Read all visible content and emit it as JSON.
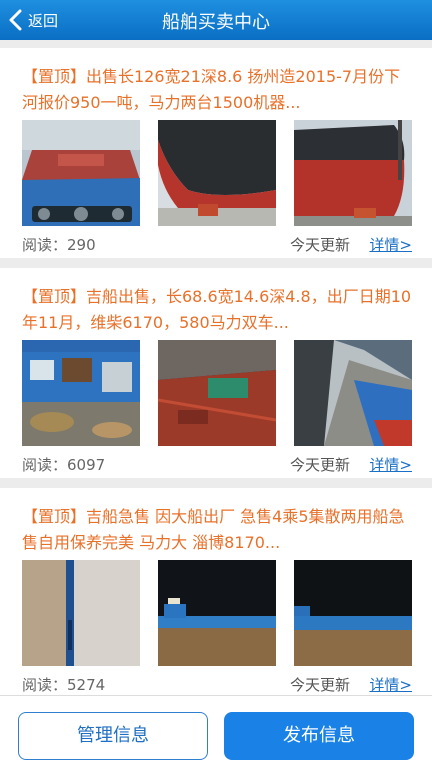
{
  "header": {
    "back_label": "返回",
    "title": "船舶买卖中心"
  },
  "listings": [
    {
      "title": "【置顶】出售长126宽21深8.6 扬州造2015-7月份下河报价950一吨，马力两台1500机器...",
      "reads_label": "阅读：",
      "reads": "290",
      "updated": "今天更新",
      "detail_label": "详情>",
      "photos": [
        "ship-deck-photo",
        "red-hull-bow-photo",
        "red-hull-stern-photo"
      ]
    },
    {
      "title": "【置顶】吉船出售，长68.6宽14.6深4.8，出厂日期10年11月，维柴6170，580马力双车...",
      "reads_label": "阅读：",
      "reads": "6097",
      "updated": "今天更新",
      "detail_label": "详情>",
      "photos": [
        "wheelhouse-photo",
        "cargo-hold-photo",
        "ship-side-photo"
      ]
    },
    {
      "title": "【置顶】吉船急售 因大船出厂 急售4乘5集散两用船急售自用保养完美 马力大 淄博8170...",
      "reads_label": "阅读：",
      "reads": "5274",
      "updated": "今天更新",
      "detail_label": "详情>",
      "photos": [
        "hull-closeup-photo",
        "night-river-photo",
        "night-barge-photo"
      ]
    }
  ],
  "footer": {
    "manage_label": "管理信息",
    "publish_label": "发布信息"
  }
}
